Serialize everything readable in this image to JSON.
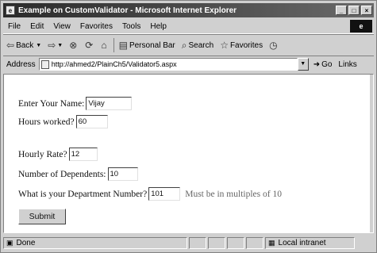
{
  "window": {
    "title": "Example on CustomValidator - Microsoft Internet Explorer",
    "buttons": [
      "_",
      "□",
      "×"
    ]
  },
  "menu": {
    "items": [
      "File",
      "Edit",
      "View",
      "Favorites",
      "Tools",
      "Help"
    ]
  },
  "toolbar": {
    "back_label": "Back",
    "search_label": "Search",
    "favorites_label": "Favorites",
    "personal_bar_label": "Personal Bar"
  },
  "address": {
    "label": "Address",
    "url": "http://ahmed2/PlainCh5/Validator5.aspx",
    "go_label": "Go",
    "links_label": "Links"
  },
  "form": {
    "name_label": "Enter Your Name:",
    "name_value": "Vijay",
    "hours_label": "Hours worked?",
    "hours_value": "60",
    "rate_label": "Hourly Rate?",
    "rate_value": "12",
    "dependents_label": "Number of Dependents:",
    "dependents_value": "10",
    "department_label": "What is your Department Number?",
    "department_value": "101",
    "department_error": "Must be in multiples of 10",
    "submit_label": "Submit"
  },
  "status": {
    "text": "Done",
    "zone": "Local intranet"
  }
}
